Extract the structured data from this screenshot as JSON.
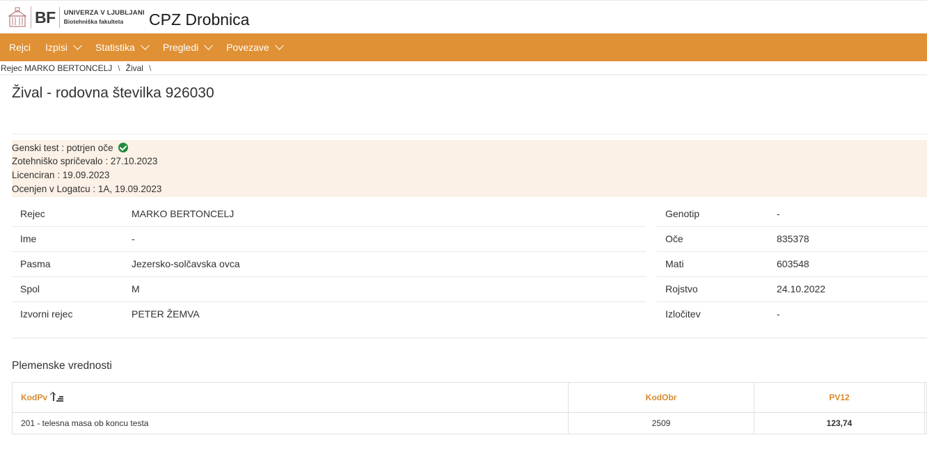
{
  "header": {
    "logo_bf": "BF",
    "logo_line1": "UNIVERZA V LJUBLJANI",
    "logo_line2": "Biotehniška fakulteta",
    "app_title": "CPZ Drobnica"
  },
  "nav": {
    "items": [
      {
        "label": "Rejci",
        "dropdown": false
      },
      {
        "label": "Izpisi",
        "dropdown": true
      },
      {
        "label": "Statistika",
        "dropdown": true
      },
      {
        "label": "Pregledi",
        "dropdown": true
      },
      {
        "label": "Povezave",
        "dropdown": true
      }
    ],
    "color": "#e09035"
  },
  "breadcrumb": {
    "items": [
      "Rejec MARKO BERTONCELJ",
      "Žival"
    ],
    "separator": "\\"
  },
  "page_title": "Žival - rodovna številka 926030",
  "info": {
    "genetic_test": "Genski test : potrjen oče",
    "certificate": "Zotehniško spričevalo : 27.10.2023",
    "licensed": "Licenciran : 19.09.2023",
    "evaluated": "Ocenjen v Logatcu : 1A, 19.09.2023",
    "check_icon": "check-circle-icon"
  },
  "details_left": [
    {
      "label": "Rejec",
      "value": "MARKO BERTONCELJ"
    },
    {
      "label": "Ime",
      "value": "-"
    },
    {
      "label": "Pasma",
      "value": "Jezersko-solčavska ovca"
    },
    {
      "label": "Spol",
      "value": "M"
    },
    {
      "label": "Izvorni rejec",
      "value": "PETER ŽEMVA"
    }
  ],
  "details_right": [
    {
      "label": "Genotip",
      "value": "-"
    },
    {
      "label": "Oče",
      "value": "835378"
    },
    {
      "label": "Mati",
      "value": "603548"
    },
    {
      "label": "Rojstvo",
      "value": "24.10.2022"
    },
    {
      "label": "Izločitev",
      "value": "-"
    }
  ],
  "breeding": {
    "title": "Plemenske vrednosti",
    "columns": [
      "KodPv",
      "KodObr",
      "PV12"
    ],
    "rows": [
      [
        "201 - telesna masa ob koncu testa",
        "2509",
        "123,74"
      ]
    ]
  },
  "colors": {
    "accent": "#e09035",
    "link": "#d98a2e",
    "info_bg": "#fbf1e6",
    "success": "#1f8a3a"
  }
}
